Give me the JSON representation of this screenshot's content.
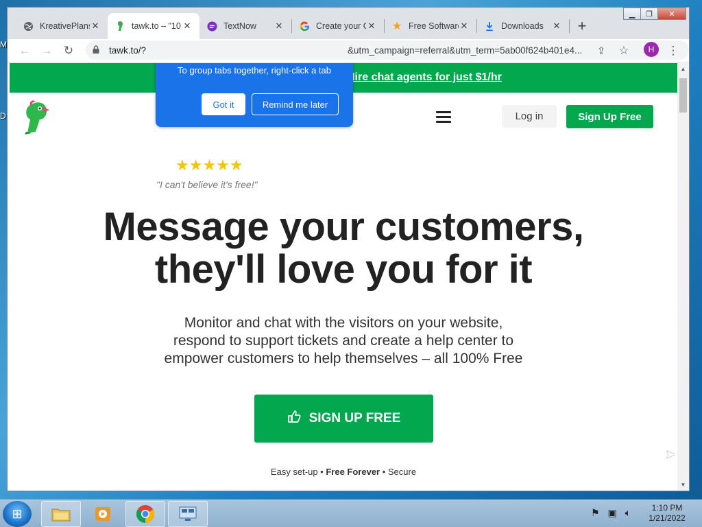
{
  "desktop": {
    "frag_top": "M",
    "frag_mid": "D"
  },
  "browser": {
    "tabs": [
      {
        "title": "KreativePlans",
        "icon": "globe-icon",
        "active": false
      },
      {
        "title": "tawk.to – \"10",
        "icon": "tawk-parrot-icon",
        "active": true
      },
      {
        "title": "TextNow",
        "icon": "textnow-icon",
        "active": false
      },
      {
        "title": "Create your G",
        "icon": "google-icon",
        "active": false
      },
      {
        "title": "Free Software",
        "icon": "star-icon",
        "active": false
      },
      {
        "title": "Downloads",
        "icon": "download-icon",
        "active": false
      }
    ],
    "new_tab": "+",
    "url_start": "tawk.to/?",
    "url_end": "&utm_campaign=referral&utm_term=5ab00f624b401e4...",
    "profile_initial": "H"
  },
  "tip": {
    "text": "To group tabs together, right-click a tab",
    "got_it": "Got it",
    "remind_later": "Remind me later"
  },
  "page": {
    "banner_link": "Hire chat agents for just $1/hr",
    "login": "Log in",
    "signup_top": "Sign Up Free",
    "stars": "★★★★★",
    "quote": "\"I can't believe it's free!\"",
    "headline_line1": "Message your customers,",
    "headline_line2": "they'll love you for it",
    "sub_line1": "Monitor and chat with the visitors on your website,",
    "sub_line2": "respond to support tickets and create a help center to",
    "sub_line3": "empower customers to help themselves – all 100% Free",
    "cta": "SIGN UP FREE",
    "tagline_a": "Easy set-up • ",
    "tagline_b": "Free Forever",
    "tagline_c": " • Secure"
  },
  "colors": {
    "brand_green": "#03a84e",
    "tip_blue": "#1a73e8"
  },
  "taskbar": {
    "time": "1:10 PM",
    "date": "1/21/2022"
  }
}
